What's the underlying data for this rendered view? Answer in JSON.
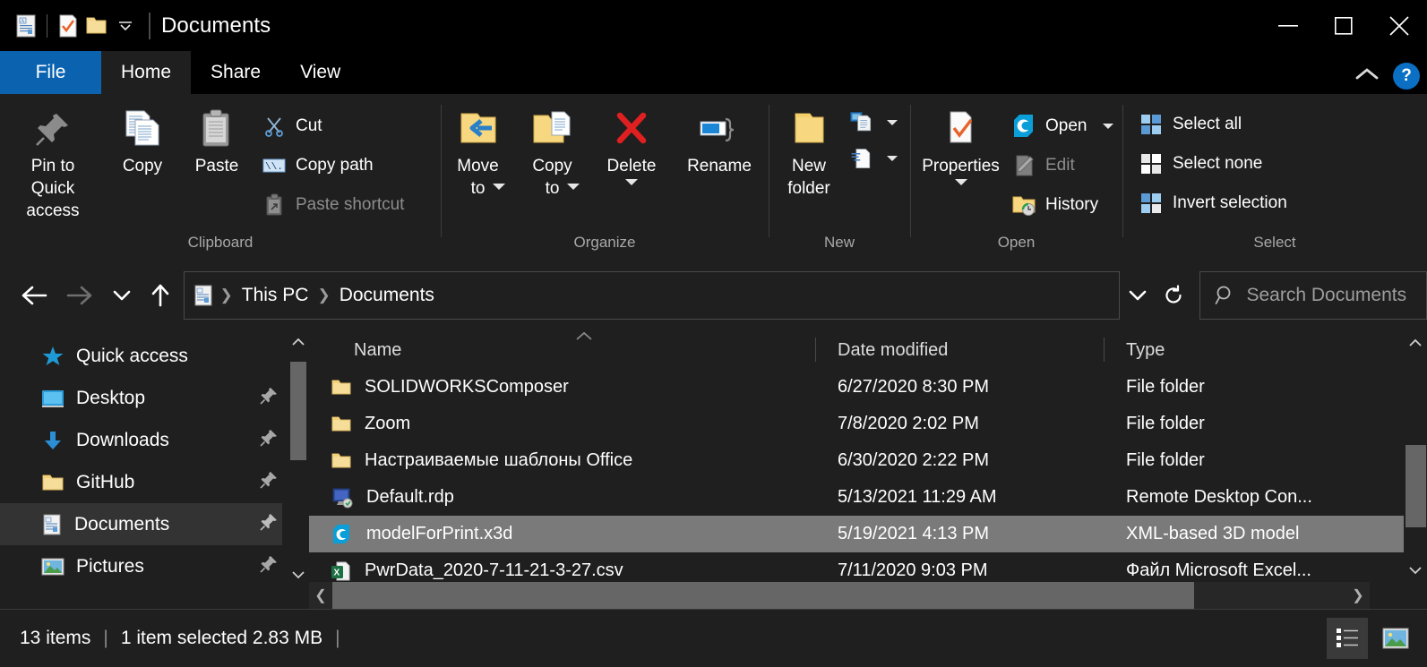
{
  "window": {
    "title": "Documents",
    "quick_access_toolbar": [
      {
        "name": "properties-doc-icon",
        "label": "Properties"
      },
      {
        "name": "new-folder-icon",
        "label": "New folder"
      },
      {
        "name": "customize-qat-dropdown",
        "label": "Customize Quick Access Toolbar"
      }
    ],
    "controls": {
      "minimize": "Minimize",
      "maximize": "Maximize",
      "close": "Close"
    }
  },
  "tabs": [
    {
      "label": "File",
      "type": "file"
    },
    {
      "label": "Home",
      "type": "active"
    },
    {
      "label": "Share",
      "type": "normal"
    },
    {
      "label": "View",
      "type": "normal"
    }
  ],
  "ribbon": {
    "collapse_label": "Minimize the Ribbon",
    "help_label": "?",
    "groups": [
      {
        "label": "Clipboard",
        "big_buttons": [
          {
            "label": "Pin to Quick\naccess",
            "icon": "pin-icon"
          },
          {
            "label": "Copy",
            "icon": "copy-icon"
          },
          {
            "label": "Paste",
            "icon": "paste-icon"
          }
        ],
        "small_buttons": [
          {
            "label": "Cut",
            "icon": "scissors-icon",
            "dim": false
          },
          {
            "label": "Copy path",
            "icon": "copy-path-icon",
            "dim": false
          },
          {
            "label": "Paste shortcut",
            "icon": "paste-shortcut-icon",
            "dim": true
          }
        ]
      },
      {
        "label": "Organize",
        "big_buttons": [
          {
            "label": "Move\nto",
            "icon": "move-to-icon",
            "caret": true
          },
          {
            "label": "Copy\nto",
            "icon": "copy-to-icon",
            "caret": true
          },
          {
            "label": "Delete",
            "icon": "delete-icon",
            "caret": true
          },
          {
            "label": "Rename",
            "icon": "rename-icon",
            "caret": false
          }
        ]
      },
      {
        "label": "New",
        "big_buttons": [
          {
            "label": "New\nfolder",
            "icon": "new-folder-icon"
          }
        ],
        "small_buttons": [
          {
            "label": "New item",
            "icon": "new-item-icon",
            "caret": true
          },
          {
            "label": "Easy access",
            "icon": "easy-access-icon",
            "caret": true
          }
        ]
      },
      {
        "label": "Open",
        "big_buttons": [
          {
            "label": "Properties",
            "icon": "properties-icon",
            "caret": true
          }
        ],
        "small_buttons": [
          {
            "label": "Open",
            "icon": "open-app-icon",
            "dim": false,
            "caret": true
          },
          {
            "label": "Edit",
            "icon": "edit-icon",
            "dim": true
          },
          {
            "label": "History",
            "icon": "history-icon",
            "dim": false
          }
        ]
      },
      {
        "label": "Select",
        "small_buttons": [
          {
            "label": "Select all",
            "icon": "select-all-icon"
          },
          {
            "label": "Select none",
            "icon": "select-none-icon"
          },
          {
            "label": "Invert selection",
            "icon": "invert-selection-icon"
          }
        ]
      }
    ]
  },
  "address_bar": {
    "back": "Back",
    "forward": "Forward",
    "recent": "Recent locations",
    "up": "Up",
    "breadcrumb": [
      "This PC",
      "Documents"
    ],
    "breadcrumb_icon": "documents-icon",
    "dropdown": "Previous locations",
    "refresh": "Refresh",
    "search_placeholder": "Search Documents"
  },
  "sidebar": {
    "items": [
      {
        "label": "Quick access",
        "icon": "star-icon",
        "pinned": false,
        "selected": false
      },
      {
        "label": "Desktop",
        "icon": "desktop-icon",
        "pinned": true,
        "selected": false
      },
      {
        "label": "Downloads",
        "icon": "downloads-icon",
        "pinned": true,
        "selected": false
      },
      {
        "label": "GitHub",
        "icon": "folder-icon",
        "pinned": true,
        "selected": false
      },
      {
        "label": "Documents",
        "icon": "documents-icon",
        "pinned": true,
        "selected": true
      },
      {
        "label": "Pictures",
        "icon": "pictures-icon",
        "pinned": true,
        "selected": false
      }
    ]
  },
  "file_list": {
    "columns": [
      "Name",
      "Date modified",
      "Type"
    ],
    "rows": [
      {
        "name": "SOLIDWORKSComposer",
        "date": "6/27/2020 8:30 PM",
        "type": "File folder",
        "icon": "folder-icon",
        "selected": false
      },
      {
        "name": "Zoom",
        "date": "7/8/2020 2:02 PM",
        "type": "File folder",
        "icon": "folder-icon",
        "selected": false
      },
      {
        "name": "Настраиваемые шаблоны Office",
        "date": "6/30/2020 2:22 PM",
        "type": "File folder",
        "icon": "folder-icon",
        "selected": false
      },
      {
        "name": "Default.rdp",
        "date": "5/13/2021 11:29 AM",
        "type": "Remote Desktop Con...",
        "icon": "rdp-icon",
        "selected": false
      },
      {
        "name": "modelForPrint.x3d",
        "date": "5/19/2021 4:13 PM",
        "type": "XML-based 3D model",
        "icon": "composer-icon",
        "selected": true
      },
      {
        "name": "PwrData_2020-7-11-21-3-27.csv",
        "date": "7/11/2020 9:03 PM",
        "type": "Файл Microsoft Excel...",
        "icon": "excel-icon",
        "selected": false
      }
    ]
  },
  "status_bar": {
    "item_count": "13 items",
    "separator": "|",
    "selection": "1 item selected  2.83 MB",
    "trailing_separator": "|",
    "view_details": "Details view",
    "view_large_icons": "Large icons view"
  },
  "colors": {
    "accent": "#0b63b0",
    "window_bg": "#1f1f1f",
    "titlebar_bg": "#000000",
    "selection": "#7a7a7a",
    "sidebar_selection": "#333333",
    "help_blue": "#0b6fc4",
    "folder_yellow": "#f5d783",
    "delete_red": "#e02020"
  }
}
